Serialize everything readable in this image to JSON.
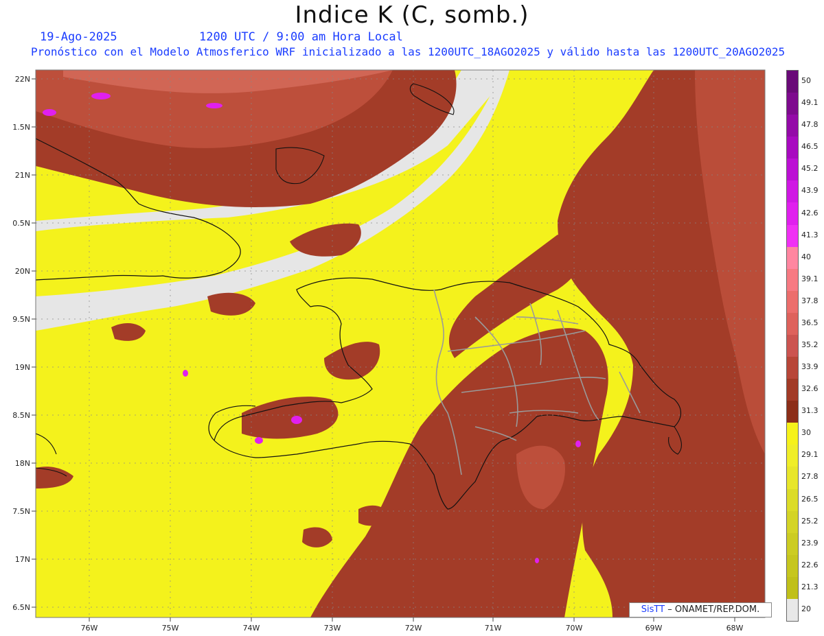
{
  "title": "Indice K (C, somb.)",
  "date": "19-Ago-2025",
  "utc": "1200 UTC / 9:00 am Hora Local",
  "description": "Pronóstico con el Modelo Atmosferico WRF inicializado a las 1200UTC_18AGO2025 y válido hasta las  1200UTC_20AGO2025",
  "lat_labels": [
    "22N",
    "1.5N",
    "21N",
    "0.5N",
    "20N",
    "9.5N",
    "19N",
    "8.5N",
    "18N",
    "7.5N",
    "17N",
    "6.5N"
  ],
  "lon_labels": [
    "76W",
    "75W",
    "74W",
    "73W",
    "72W",
    "71W",
    "70W",
    "69W",
    "68W"
  ],
  "colorbar": {
    "labels": [
      "50",
      "49.1",
      "47.8",
      "46.5",
      "45.2",
      "43.9",
      "42.6",
      "41.3",
      "40",
      "39.1",
      "37.8",
      "36.5",
      "35.2",
      "33.9",
      "32.6",
      "31.3",
      "30",
      "29.1",
      "27.8",
      "26.5",
      "25.2",
      "23.9",
      "22.6",
      "21.3",
      "20"
    ],
    "colors": [
      "#6a0a78",
      "#7e0a8e",
      "#940aa8",
      "#a80ac0",
      "#bc10d4",
      "#d018e4",
      "#e020ee",
      "#f030f4",
      "#ff86a0",
      "#f77a82",
      "#ec6e6c",
      "#de625c",
      "#cc5450",
      "#b84638",
      "#a23a26",
      "#8c2e18",
      "#f6f21a",
      "#f0ee28",
      "#e8e62a",
      "#dcdc28",
      "#d4d426",
      "#cccc22",
      "#c6c61e",
      "#c0c01a",
      "#e8e8e8"
    ]
  },
  "credit": {
    "brand": "SisTT",
    "text": " – ONAMET/REP.DOM."
  }
}
